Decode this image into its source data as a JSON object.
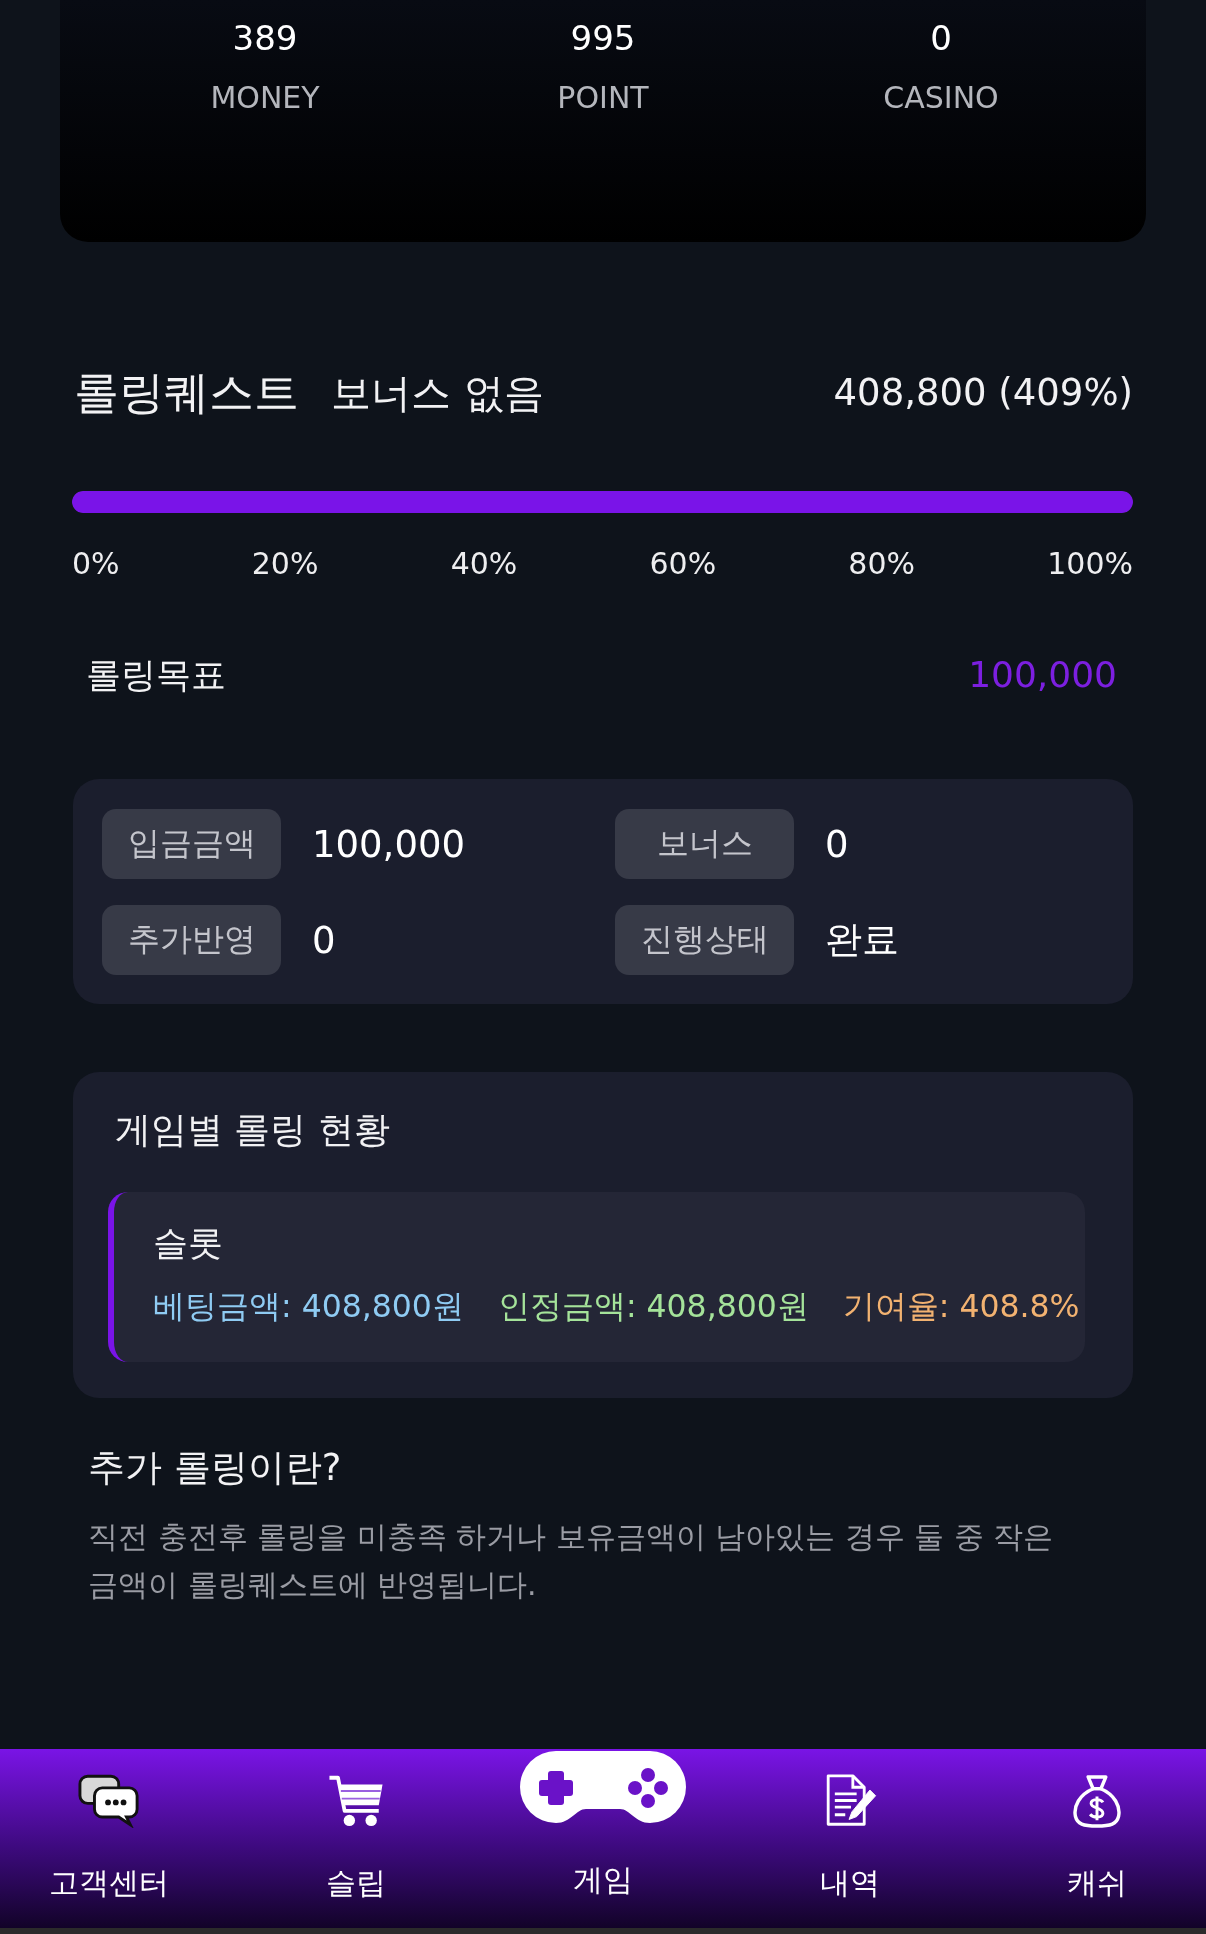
{
  "balance_card": {
    "stats": [
      {
        "value": "389",
        "label": "MONEY"
      },
      {
        "value": "995",
        "label": "POINT"
      },
      {
        "value": "0",
        "label": "CASINO"
      }
    ]
  },
  "rolling_quest": {
    "title": "롤링퀘스트",
    "bonus_status": "보너스 없음",
    "amount": "408,800 (409%)",
    "progress": {
      "level": 1
    },
    "scale": [
      "0%",
      "20%",
      "40%",
      "60%",
      "80%",
      "100%"
    ],
    "target_label": "롤링목표",
    "target_value": "100,000"
  },
  "details": [
    {
      "label": "입금금액",
      "value": "100,000"
    },
    {
      "label": "보너스",
      "value": "0"
    },
    {
      "label": "추가반영",
      "value": "0"
    },
    {
      "label": "진행상태",
      "value": "완료"
    }
  ],
  "game_rolling": {
    "title": "게임별 롤링 현황",
    "games": [
      {
        "name": "슬롯",
        "stats": [
          {
            "text": "베팅금액: 408,800원",
            "color": "#8fcbf3"
          },
          {
            "text": "인정금액: 408,800원",
            "color": "#a5e39a"
          },
          {
            "text": "기여율: 408.8%",
            "color": "#f2b271"
          }
        ]
      }
    ]
  },
  "info": {
    "title": "추가 롤링이란?",
    "text": "직전 충전후 롤링을 미충족 하거나 보유금액이 남아있는 경우 둘 중 작은 금액이 롤링퀘스트에 반영됩니다."
  },
  "bottom_nav": [
    {
      "label": "고객센터",
      "selected": false
    },
    {
      "label": "슬립",
      "selected": false
    },
    {
      "label": "게임",
      "selected": true
    },
    {
      "label": "내역",
      "selected": false
    },
    {
      "label": "캐쉬",
      "selected": false
    }
  ]
}
